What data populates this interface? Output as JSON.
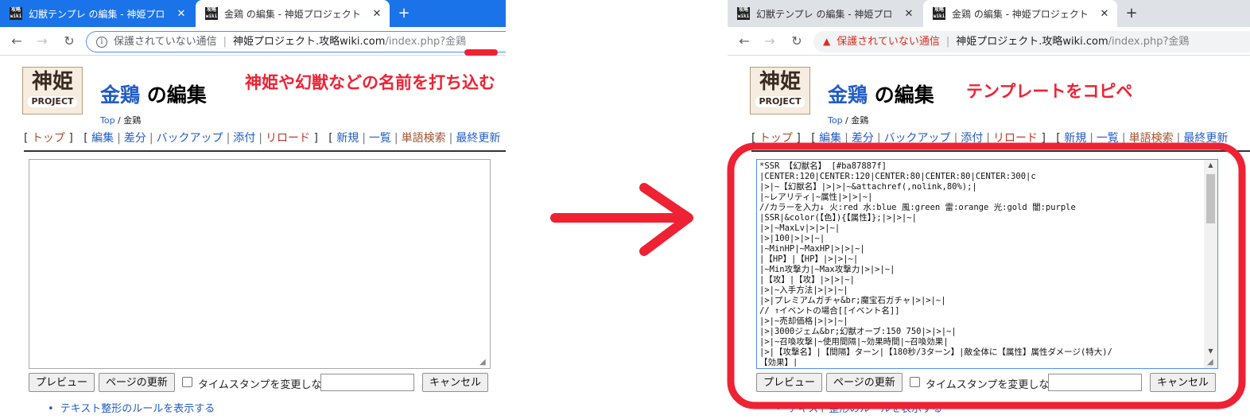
{
  "left": {
    "tabs": [
      {
        "title": "幻獣テンプレ の編集 - 神姫プロ"
      },
      {
        "title": "金鶏 の編集 - 神姫プロジェクト"
      }
    ],
    "omnibox": {
      "status": "保護されていない通信",
      "host": "神姫プロジェクト.攻略wiki.com",
      "path": "/index.php?金鶏"
    },
    "annotation": "神姫や幻獣などの名前を打ち込む",
    "editor_text": ""
  },
  "right": {
    "tabs": [
      {
        "title": "幻獣テンプレ の編集 - 神姫プロ"
      },
      {
        "title": "金鶏 の編集 - 神姫プロジェクト"
      }
    ],
    "omnibox": {
      "status": "保護されていない通信",
      "host": "神姫プロジェクト.攻略wiki.com",
      "path": "/index.php?金鶏"
    },
    "annotation": "テンプレートをコピペ",
    "editor_text": "*SSR 【幻獣名】 [#ba87887f]\n|CENTER:120|CENTER:120|CENTER:80|CENTER:80|CENTER:300|c\n|>|~【幻獣名】|>|>|~&attachref(,nolink,80%);|\n|~レアリティ|~属性|>|>|~|\n//カラーを入力↓ 火:red 水:blue 風:green 雷:orange 光:gold 闇:purple\n|SSR|&color(【色】){【属性】};|>|>|~|\n|>|~MaxLv|>|>|~|\n|>|100|>|>|~|\n|~MinHP|~MaxHP|>|>|~|\n|【HP】|【HP】|>|>|~|\n|~Min攻撃力|~Max攻撃力|>|>|~|\n|【攻】|【攻】|>|>|~|\n|>|~入手方法|>|>|~|\n|>|プレミアムガチャ&br;魔宝石ガチャ|>|>|~|\n// ↑イベントの場合[[イベント名]]\n|>|~売却価格|>|>|~|\n|>|3000ジェム&br;幻獣オーブ:150 750|>|>|~|\n|>|~召喚攻撃|~使用間隔|~効果時間|~召喚効果|\n|>|【攻撃名】|【間隔】ターン|【180秒/3ターン】|敵全体に【属性】属性ダメージ(特大)/\n【効果】|"
  },
  "shared": {
    "wiki_name": "金鶏",
    "edit_suffix": " の編集",
    "logo_kanji": "神姫",
    "logo_project": "PROJECT",
    "breadcrumb_top": "Top",
    "breadcrumb_sep": " / ",
    "breadcrumb_current": "金鶏",
    "menu": {
      "top": "トップ",
      "edit": "編集",
      "diff": "差分",
      "backup": "バックアップ",
      "attach": "添付",
      "reload": "リロード",
      "new": "新規",
      "list": "一覧",
      "word_search": "単語検索",
      "recent": "最終更新"
    },
    "buttons": {
      "preview": "プレビュー",
      "update": "ページの更新",
      "cancel": "キャンセル"
    },
    "timestamp_label": "タイムスタンプを変更しない",
    "rules_link": "テキスト整形のルールを表示する",
    "favicon_text": "攻略\nwiki"
  },
  "colors": {
    "accent_red": "#ee2233",
    "link_blue": "#215dc6",
    "tab_bar_blue": "#1a73e8"
  }
}
